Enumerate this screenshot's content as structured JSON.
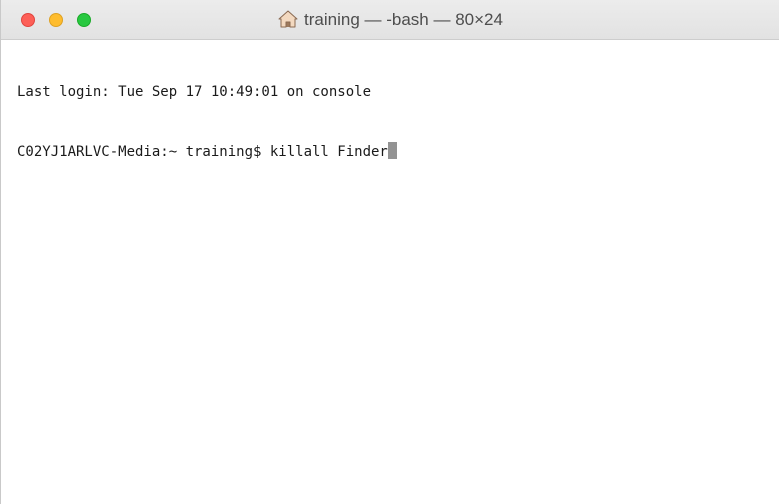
{
  "window": {
    "title": "training — -bash — 80×24",
    "title_icon": "home-icon"
  },
  "terminal": {
    "lines": [
      "Last login: Tue Sep 17 10:49:01 on console",
      "C02YJ1ARLVC-Media:~ training$ killall Finder"
    ]
  },
  "colors": {
    "close": "#fd5f57",
    "minimize": "#febc2e",
    "zoom": "#28c840",
    "cursor": "#939393"
  }
}
